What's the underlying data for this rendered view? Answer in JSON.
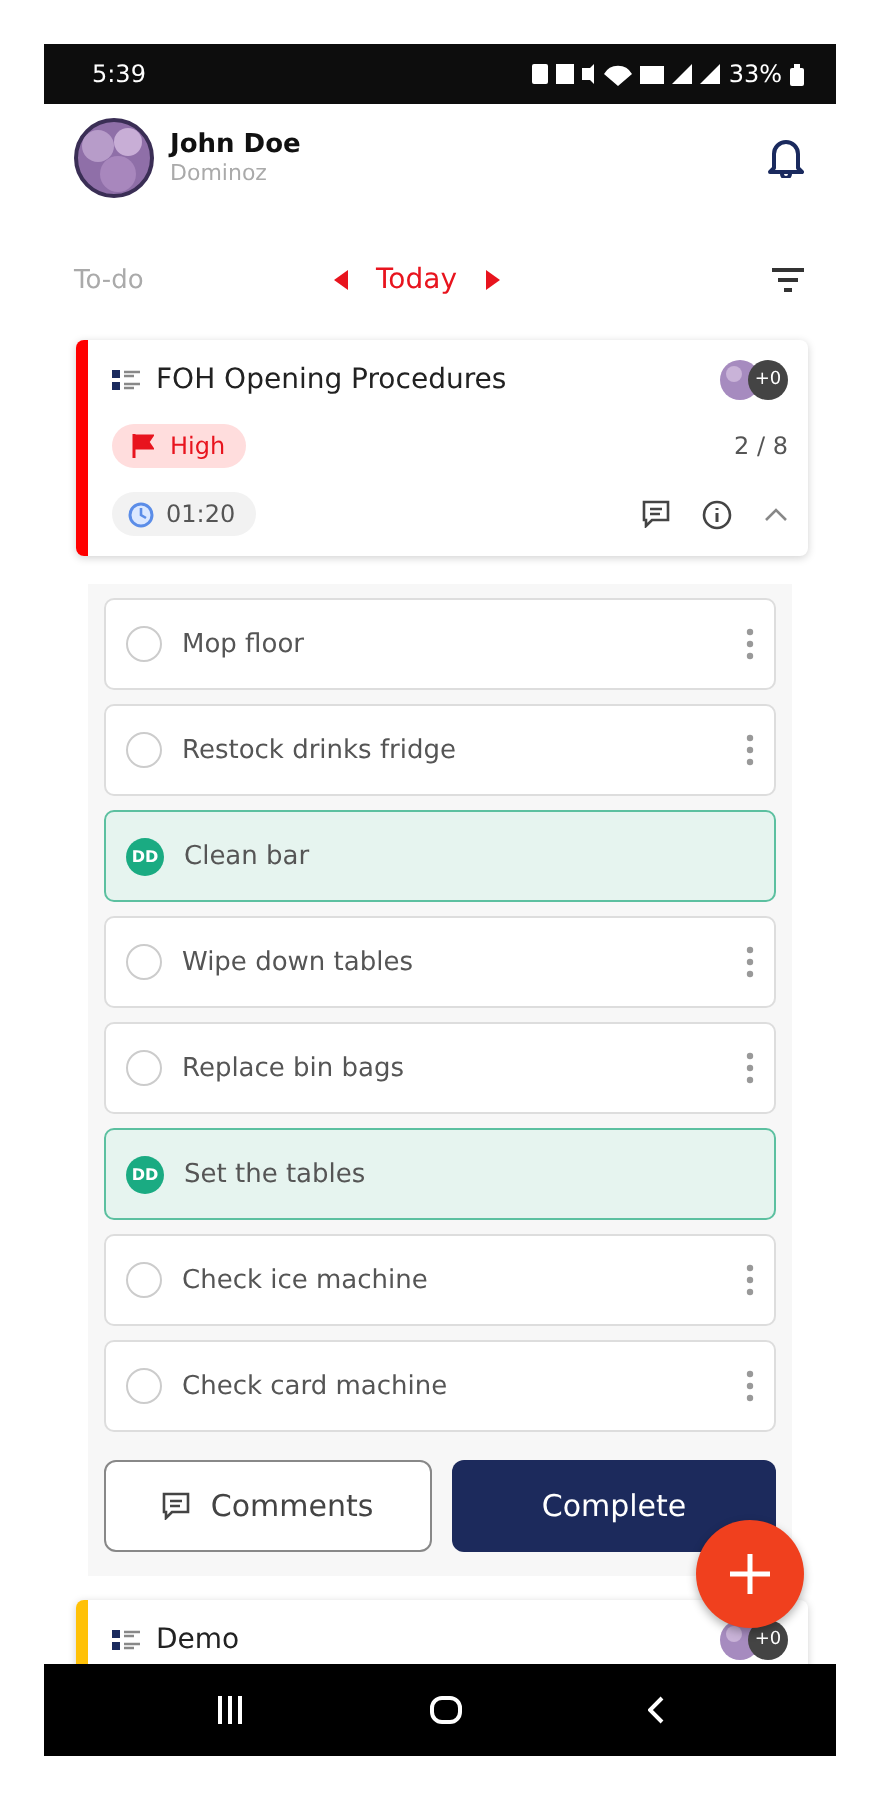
{
  "status_bar": {
    "time": "5:39",
    "battery": "33%"
  },
  "user": {
    "name": "John Doe",
    "org": "Dominoz"
  },
  "nav": {
    "left": "To-do",
    "date": "Today"
  },
  "cards": [
    {
      "title": "FOH Opening Procedures",
      "priority": "High",
      "progress": "2 / 8",
      "timer": "01:20",
      "assignee_extra": "+0",
      "color": "#ff0000",
      "expanded": true,
      "tasks": [
        {
          "label": "Mop floor",
          "done": false
        },
        {
          "label": "Restock drinks fridge",
          "done": false
        },
        {
          "label": "Clean bar",
          "done": true,
          "initials": "DD"
        },
        {
          "label": "Wipe down tables",
          "done": false
        },
        {
          "label": "Replace bin bags",
          "done": false
        },
        {
          "label": "Set the tables",
          "done": true,
          "initials": "DD"
        },
        {
          "label": "Check ice machine",
          "done": false
        },
        {
          "label": "Check card machine",
          "done": false
        }
      ],
      "buttons": {
        "comments": "Comments",
        "complete": "Complete"
      }
    },
    {
      "title": "Demo",
      "assignee_extra": "+0",
      "color": "#ffc107",
      "expanded": false
    }
  ]
}
